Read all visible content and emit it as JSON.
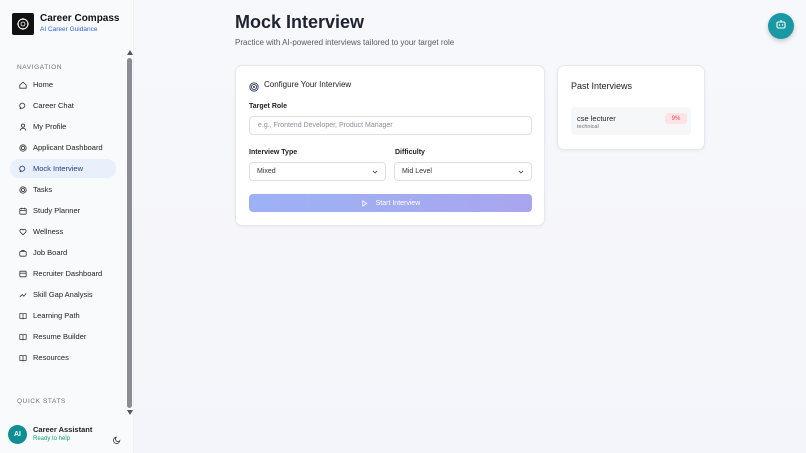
{
  "brand": {
    "title": "Career Compass",
    "subtitle": "AI Career Guidance"
  },
  "sidebar": {
    "heading": "NAVIGATION",
    "items": [
      {
        "label": "Home",
        "icon": "home-icon"
      },
      {
        "label": "Career Chat",
        "icon": "chat-icon"
      },
      {
        "label": "My Profile",
        "icon": "user-icon"
      },
      {
        "label": "Applicant Dashboard",
        "icon": "target-icon"
      },
      {
        "label": "Mock Interview",
        "icon": "chat-icon",
        "active": true
      },
      {
        "label": "Tasks",
        "icon": "target-icon"
      },
      {
        "label": "Study Planner",
        "icon": "calendar-icon"
      },
      {
        "label": "Wellness",
        "icon": "heart-icon"
      },
      {
        "label": "Job Board",
        "icon": "briefcase-icon"
      },
      {
        "label": "Recruiter Dashboard",
        "icon": "users-icon"
      },
      {
        "label": "Skill Gap Analysis",
        "icon": "trend-icon"
      },
      {
        "label": "Learning Path",
        "icon": "book-icon"
      },
      {
        "label": "Resume Builder",
        "icon": "book-icon"
      },
      {
        "label": "Resources",
        "icon": "book-icon"
      }
    ],
    "quick_stats_heading": "QUICK STATS"
  },
  "user": {
    "initials": "AI",
    "name": "Career Assistant",
    "status": "Ready to help"
  },
  "main": {
    "title": "Mock Interview",
    "subtitle": "Practice with AI-powered interviews tailored to your target role"
  },
  "config": {
    "title": "Configure Your Interview",
    "target_role_label": "Target Role",
    "target_role_placeholder": "e.g., Frontend Developer, Product Manager",
    "interview_type_label": "Interview Type",
    "interview_type_value": "Mixed",
    "difficulty_label": "Difficulty",
    "difficulty_value": "Mid Level",
    "start_button": "Start Interview"
  },
  "past": {
    "title": "Past Interviews",
    "items": [
      {
        "role": "cse lecturer",
        "type": "technical",
        "score": "9%"
      }
    ]
  },
  "colors": {
    "accent": "#1a98a3",
    "brand_link": "#2e64d8",
    "active_nav_bg": "#e9effb"
  }
}
